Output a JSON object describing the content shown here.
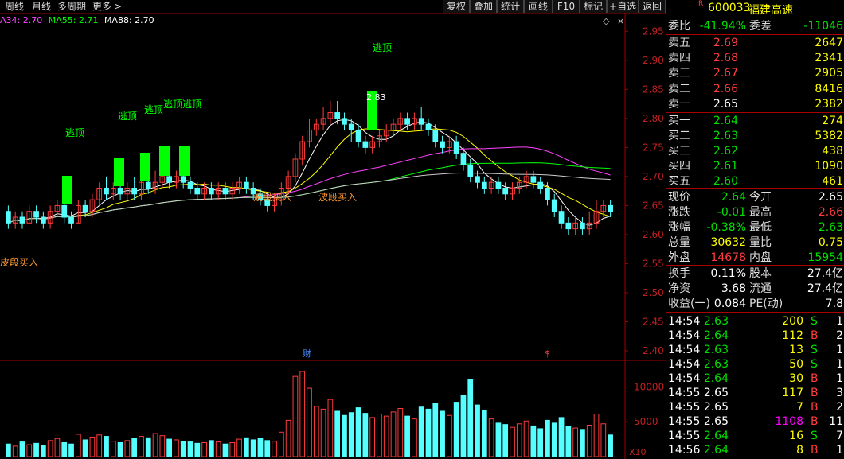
{
  "toolbar": {
    "left_items": [
      "周线",
      "月线",
      "多周期",
      "更多"
    ],
    "more_arrow": ">",
    "right_buttons": [
      "复权",
      "叠加",
      "统计",
      "画线",
      "F10",
      "标记",
      "+自选",
      "返回"
    ]
  },
  "ma_legend": [
    {
      "text": "A34: 2.70",
      "color": "#ff44ff"
    },
    {
      "text": "MA55: 2.71",
      "color": "#00ff00"
    },
    {
      "text": "MA88: 2.70",
      "color": "#ffffff"
    }
  ],
  "chart_data": {
    "type": "candlestick",
    "price_axis": {
      "ticks": [
        "2.95",
        "2.90",
        "2.85",
        "2.80",
        "2.75",
        "2.70",
        "2.65",
        "2.60",
        "2.55",
        "2.50",
        "2.45",
        "2.40"
      ],
      "ylim": [
        2.4,
        2.96
      ]
    },
    "volume_axis": {
      "ticks": [
        "10000",
        "5000"
      ],
      "unit_label": "X10"
    },
    "annotations": {
      "escape_top": "逃顶",
      "escape_top_double": "逃顶逃顶",
      "wave_buy": "波段买入",
      "wave_buy_cut": "皮段买入",
      "high_label": "2.83",
      "finance_marker": "财",
      "s_marker": "$"
    },
    "candles": [
      [
        2.64,
        2.62,
        2.65,
        2.61,
        1800
      ],
      [
        2.62,
        2.63,
        2.64,
        2.61,
        1500
      ],
      [
        2.63,
        2.62,
        2.64,
        2.61,
        2100
      ],
      [
        2.62,
        2.64,
        2.65,
        2.62,
        1700
      ],
      [
        2.64,
        2.63,
        2.65,
        2.62,
        1900
      ],
      [
        2.63,
        2.62,
        2.64,
        2.61,
        1600
      ],
      [
        2.62,
        2.64,
        2.65,
        2.61,
        2300
      ],
      [
        2.64,
        2.65,
        2.66,
        2.63,
        2600
      ],
      [
        2.65,
        2.63,
        2.66,
        2.62,
        2000
      ],
      [
        2.63,
        2.62,
        2.64,
        2.61,
        1800
      ],
      [
        2.62,
        2.65,
        2.66,
        2.62,
        3200
      ],
      [
        2.65,
        2.64,
        2.66,
        2.63,
        2400
      ],
      [
        2.64,
        2.66,
        2.67,
        2.63,
        2800
      ],
      [
        2.66,
        2.68,
        2.69,
        2.65,
        3100
      ],
      [
        2.68,
        2.67,
        2.7,
        2.66,
        2900
      ],
      [
        2.67,
        2.68,
        2.69,
        2.66,
        2200
      ],
      [
        2.68,
        2.67,
        2.69,
        2.66,
        2000
      ],
      [
        2.67,
        2.68,
        2.69,
        2.66,
        2300
      ],
      [
        2.68,
        2.67,
        2.7,
        2.66,
        2600
      ],
      [
        2.67,
        2.69,
        2.7,
        2.66,
        2900
      ],
      [
        2.69,
        2.68,
        2.7,
        2.67,
        2700
      ],
      [
        2.68,
        2.69,
        2.71,
        2.67,
        3300
      ],
      [
        2.69,
        2.7,
        2.71,
        2.68,
        3000
      ],
      [
        2.7,
        2.69,
        2.71,
        2.68,
        2500
      ],
      [
        2.69,
        2.7,
        2.71,
        2.68,
        2400
      ],
      [
        2.7,
        2.69,
        2.71,
        2.68,
        2200
      ],
      [
        2.69,
        2.68,
        2.7,
        2.67,
        2100
      ],
      [
        2.68,
        2.67,
        2.69,
        2.66,
        1900
      ],
      [
        2.67,
        2.68,
        2.69,
        2.66,
        2000
      ],
      [
        2.68,
        2.67,
        2.69,
        2.66,
        2300
      ],
      [
        2.67,
        2.68,
        2.69,
        2.66,
        2100
      ],
      [
        2.68,
        2.67,
        2.69,
        2.66,
        1800
      ],
      [
        2.67,
        2.68,
        2.69,
        2.66,
        2000
      ],
      [
        2.68,
        2.69,
        2.7,
        2.67,
        2500
      ],
      [
        2.69,
        2.68,
        2.7,
        2.67,
        2700
      ],
      [
        2.68,
        2.67,
        2.69,
        2.66,
        2400
      ],
      [
        2.67,
        2.66,
        2.68,
        2.65,
        2600
      ],
      [
        2.66,
        2.65,
        2.67,
        2.64,
        2300
      ],
      [
        2.65,
        2.66,
        2.67,
        2.64,
        2200
      ],
      [
        2.66,
        2.68,
        2.69,
        2.65,
        3500
      ],
      [
        2.68,
        2.7,
        2.71,
        2.67,
        5200
      ],
      [
        2.7,
        2.73,
        2.74,
        2.69,
        11500
      ],
      [
        2.73,
        2.76,
        2.77,
        2.72,
        12200
      ],
      [
        2.76,
        2.78,
        2.8,
        2.75,
        9800
      ],
      [
        2.78,
        2.79,
        2.8,
        2.77,
        7200
      ],
      [
        2.79,
        2.8,
        2.82,
        2.78,
        6800
      ],
      [
        2.8,
        2.81,
        2.83,
        2.79,
        8200
      ],
      [
        2.81,
        2.8,
        2.83,
        2.79,
        6500
      ],
      [
        2.8,
        2.79,
        2.81,
        2.78,
        5900
      ],
      [
        2.79,
        2.78,
        2.8,
        2.76,
        6300
      ],
      [
        2.78,
        2.76,
        2.79,
        2.75,
        7000
      ],
      [
        2.76,
        2.75,
        2.77,
        2.74,
        6200
      ],
      [
        2.75,
        2.76,
        2.77,
        2.74,
        5600
      ],
      [
        2.76,
        2.77,
        2.78,
        2.75,
        6100
      ],
      [
        2.77,
        2.78,
        2.79,
        2.76,
        5800
      ],
      [
        2.78,
        2.79,
        2.8,
        2.77,
        6400
      ],
      [
        2.79,
        2.8,
        2.81,
        2.78,
        6900
      ],
      [
        2.8,
        2.79,
        2.81,
        2.78,
        5800
      ],
      [
        2.79,
        2.8,
        2.81,
        2.78,
        5400
      ],
      [
        2.8,
        2.79,
        2.82,
        2.78,
        7100
      ],
      [
        2.79,
        2.78,
        2.8,
        2.77,
        6800
      ],
      [
        2.78,
        2.76,
        2.79,
        2.75,
        7600
      ],
      [
        2.76,
        2.75,
        2.77,
        2.74,
        6500
      ],
      [
        2.75,
        2.76,
        2.77,
        2.74,
        5900
      ],
      [
        2.76,
        2.74,
        2.77,
        2.73,
        7800
      ],
      [
        2.74,
        2.72,
        2.75,
        2.71,
        8800
      ],
      [
        2.72,
        2.7,
        2.73,
        2.69,
        11000
      ],
      [
        2.7,
        2.69,
        2.71,
        2.68,
        7400
      ],
      [
        2.69,
        2.68,
        2.7,
        2.67,
        6600
      ],
      [
        2.68,
        2.69,
        2.7,
        2.67,
        5400
      ],
      [
        2.69,
        2.68,
        2.7,
        2.67,
        4800
      ],
      [
        2.68,
        2.67,
        2.69,
        2.66,
        4600
      ],
      [
        2.67,
        2.68,
        2.69,
        2.66,
        4200
      ],
      [
        2.68,
        2.69,
        2.7,
        2.67,
        4700
      ],
      [
        2.69,
        2.7,
        2.71,
        2.68,
        5100
      ],
      [
        2.7,
        2.69,
        2.71,
        2.68,
        4400
      ],
      [
        2.69,
        2.68,
        2.7,
        2.67,
        4000
      ],
      [
        2.68,
        2.66,
        2.69,
        2.65,
        5200
      ],
      [
        2.66,
        2.64,
        2.67,
        2.63,
        4800
      ],
      [
        2.64,
        2.62,
        2.65,
        2.61,
        5600
      ],
      [
        2.62,
        2.61,
        2.63,
        2.6,
        4300
      ],
      [
        2.61,
        2.62,
        2.63,
        2.6,
        4100
      ],
      [
        2.62,
        2.61,
        2.63,
        2.6,
        3900
      ],
      [
        2.61,
        2.62,
        2.64,
        2.6,
        4500
      ],
      [
        2.62,
        2.64,
        2.66,
        2.61,
        6100
      ],
      [
        2.64,
        2.65,
        2.66,
        2.63,
        4700
      ],
      [
        2.65,
        2.64,
        2.66,
        2.63,
        3100
      ]
    ]
  },
  "panel": {
    "r_mark": "R",
    "code": "600033",
    "name": "福建高速",
    "weibi_label": "委比",
    "weibi_value": "-41.94%",
    "weicha_label": "委差",
    "weicha_value": "-11046",
    "asks": [
      {
        "label": "卖五",
        "price": "2.69",
        "vol": "2647"
      },
      {
        "label": "卖四",
        "price": "2.68",
        "vol": "2341"
      },
      {
        "label": "卖三",
        "price": "2.67",
        "vol": "2905"
      },
      {
        "label": "卖二",
        "price": "2.66",
        "vol": "8416"
      },
      {
        "label": "卖一",
        "price": "2.65",
        "vol": "2382"
      }
    ],
    "bids": [
      {
        "label": "买一",
        "price": "2.64",
        "vol": "274"
      },
      {
        "label": "买二",
        "price": "2.63",
        "vol": "5382"
      },
      {
        "label": "买三",
        "price": "2.62",
        "vol": "438"
      },
      {
        "label": "买四",
        "price": "2.61",
        "vol": "1090"
      },
      {
        "label": "买五",
        "price": "2.60",
        "vol": "461"
      }
    ],
    "stats": [
      {
        "l1": "现价",
        "v1": "2.64",
        "c1": "green",
        "l2": "今开",
        "v2": "2.65",
        "c2": "white"
      },
      {
        "l1": "涨跌",
        "v1": "-0.01",
        "c1": "green",
        "l2": "最高",
        "v2": "2.66",
        "c2": "red"
      },
      {
        "l1": "涨幅",
        "v1": "-0.38%",
        "c1": "green",
        "l2": "最低",
        "v2": "2.63",
        "c2": "green"
      },
      {
        "l1": "总量",
        "v1": "30632",
        "c1": "yellow",
        "l2": "量比",
        "v2": "0.75",
        "c2": "yellow"
      },
      {
        "l1": "外盘",
        "v1": "14678",
        "c1": "red",
        "l2": "内盘",
        "v2": "15954",
        "c2": "green"
      }
    ],
    "stats2": [
      {
        "l1": "换手",
        "v1": "0.11%",
        "c1": "white",
        "l2": "股本",
        "v2": "27.4亿",
        "c2": "white"
      },
      {
        "l1": "净资",
        "v1": "3.68",
        "c1": "white",
        "l2": "流通",
        "v2": "27.4亿",
        "c2": "white"
      },
      {
        "l1": "收益(一)",
        "v1": "0.084",
        "c1": "white",
        "l2": "PE(动)",
        "v2": "7.8",
        "c2": "white"
      }
    ],
    "ticks": [
      {
        "time": "14:54",
        "price": "2.63",
        "pc": "green",
        "vol": "200",
        "vc": "yellow",
        "side": "S",
        "sc": "green",
        "n": "1"
      },
      {
        "time": "14:54",
        "price": "2.64",
        "pc": "green",
        "vol": "112",
        "vc": "yellow",
        "side": "B",
        "sc": "red",
        "n": "2"
      },
      {
        "time": "14:54",
        "price": "2.63",
        "pc": "green",
        "vol": "13",
        "vc": "yellow",
        "side": "S",
        "sc": "green",
        "n": "1"
      },
      {
        "time": "14:54",
        "price": "2.63",
        "pc": "green",
        "vol": "50",
        "vc": "yellow",
        "side": "S",
        "sc": "green",
        "n": "1"
      },
      {
        "time": "14:54",
        "price": "2.64",
        "pc": "green",
        "vol": "30",
        "vc": "yellow",
        "side": "B",
        "sc": "red",
        "n": "1"
      },
      {
        "time": "14:55",
        "price": "2.65",
        "pc": "white",
        "vol": "117",
        "vc": "yellow",
        "side": "B",
        "sc": "red",
        "n": "3"
      },
      {
        "time": "14:55",
        "price": "2.65",
        "pc": "white",
        "vol": "7",
        "vc": "yellow",
        "side": "B",
        "sc": "red",
        "n": "2"
      },
      {
        "time": "14:55",
        "price": "2.65",
        "pc": "white",
        "vol": "1108",
        "vc": "magenta",
        "side": "B",
        "sc": "red",
        "n": "11"
      },
      {
        "time": "14:55",
        "price": "2.64",
        "pc": "green",
        "vol": "16",
        "vc": "yellow",
        "side": "S",
        "sc": "green",
        "n": "7"
      },
      {
        "time": "14:56",
        "price": "2.64",
        "pc": "green",
        "vol": "8",
        "vc": "yellow",
        "side": "B",
        "sc": "red",
        "n": "1"
      }
    ]
  },
  "colors": {
    "up": "#ff3b3b",
    "down": "#54ffff",
    "escape": "#00ff00",
    "grid": "#a00000"
  }
}
